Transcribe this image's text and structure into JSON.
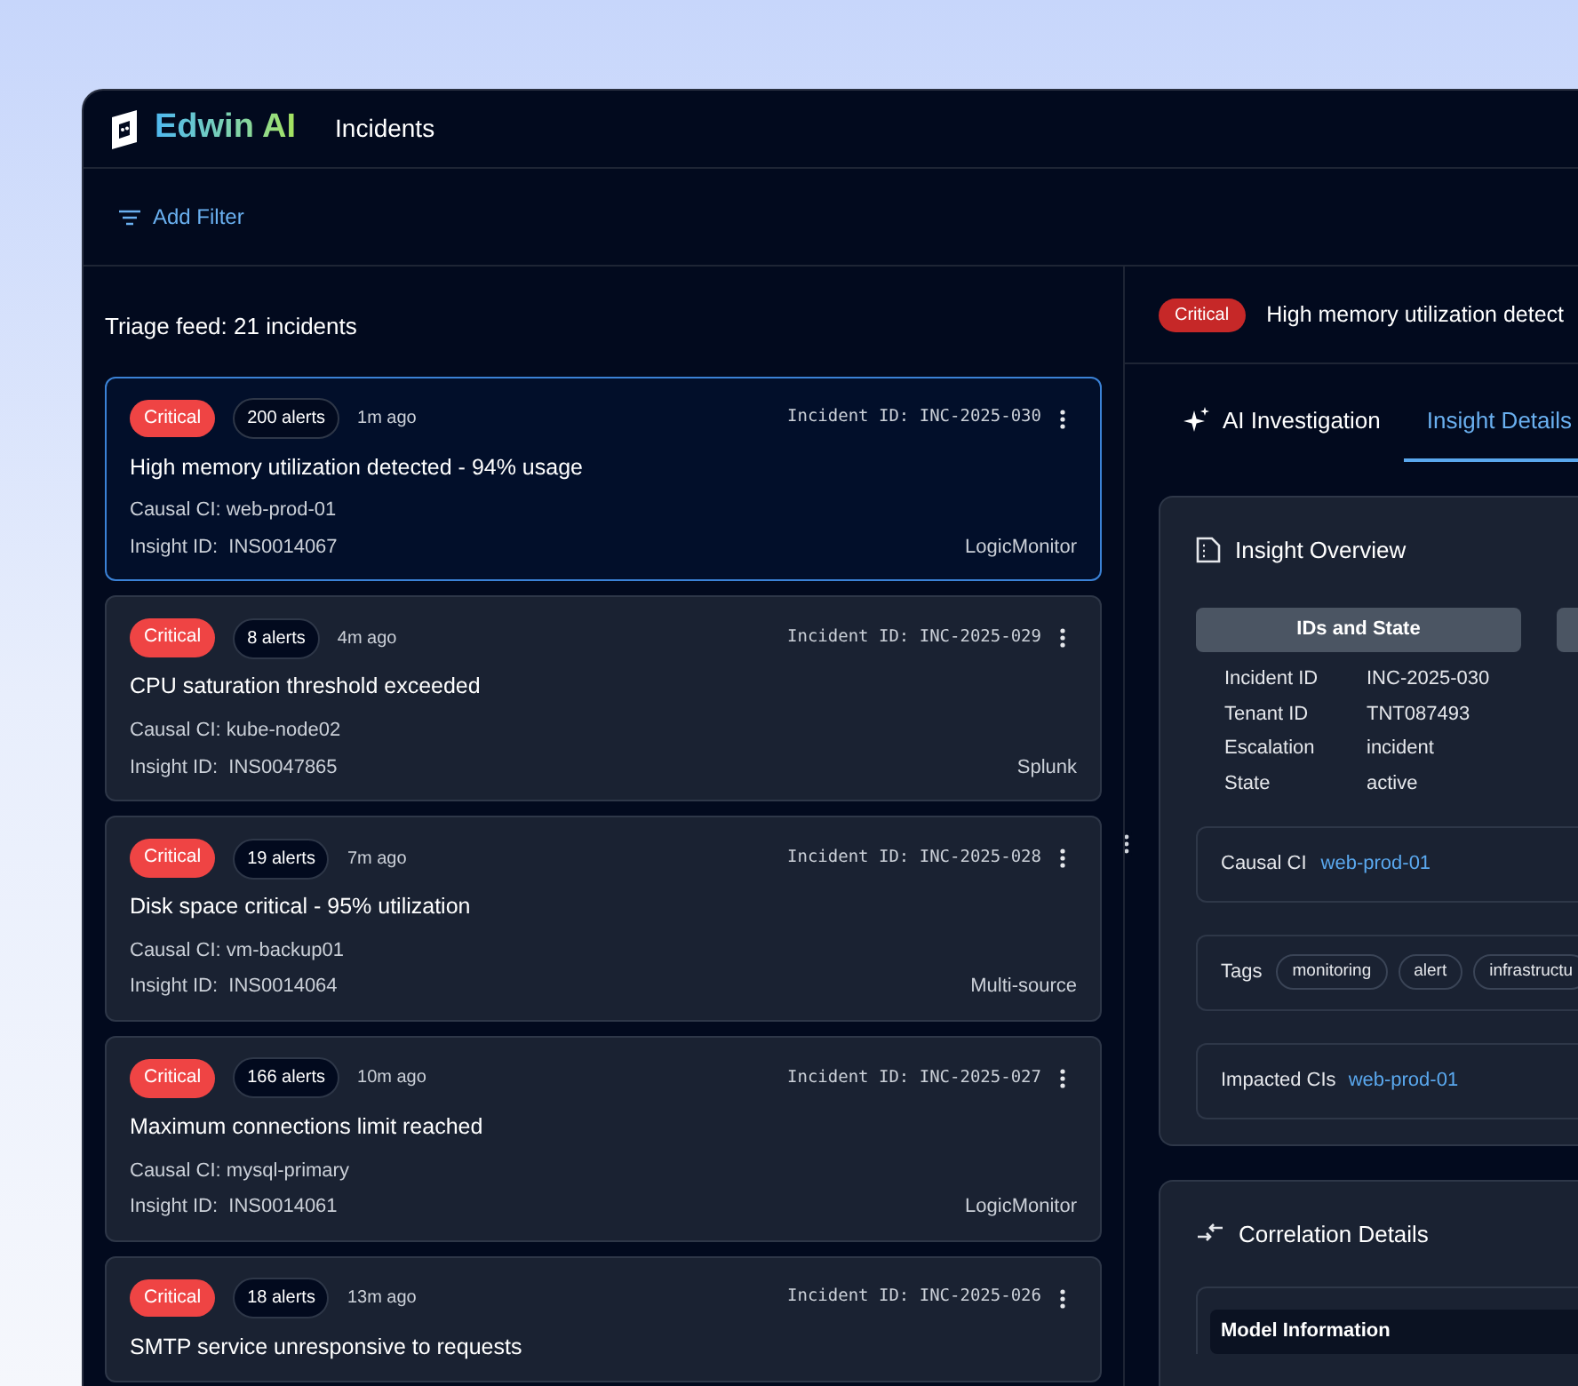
{
  "app": {
    "logo": "Edwin AI",
    "page_title": "Incidents"
  },
  "toolbar": {
    "add_filter": "Add Filter"
  },
  "feed": {
    "title": "Triage feed: 21 incidents",
    "incidents": [
      {
        "severity": "Critical",
        "alerts": "200 alerts",
        "age": "1m ago",
        "incident_id": "Incident ID: INC-2025-030",
        "title": "High memory utilization detected - 94% usage",
        "causal_ci": "Causal CI: web-prod-01",
        "insight_id": "Insight ID:  INS0014067",
        "source": "LogicMonitor",
        "selected": true
      },
      {
        "severity": "Critical",
        "alerts": "8 alerts",
        "age": "4m ago",
        "incident_id": "Incident ID: INC-2025-029",
        "title": "CPU saturation threshold exceeded",
        "causal_ci": "Causal CI: kube-node02",
        "insight_id": "Insight ID:  INS0047865",
        "source": "Splunk",
        "selected": false
      },
      {
        "severity": "Critical",
        "alerts": "19 alerts",
        "age": "7m ago",
        "incident_id": "Incident ID: INC-2025-028",
        "title": "Disk space critical - 95% utilization",
        "causal_ci": "Causal CI: vm-backup01",
        "insight_id": "Insight ID:  INS0014064",
        "source": "Multi-source",
        "selected": false
      },
      {
        "severity": "Critical",
        "alerts": "166 alerts",
        "age": "10m ago",
        "incident_id": "Incident ID: INC-2025-027",
        "title": "Maximum connections limit reached",
        "causal_ci": "Causal CI: mysql-primary",
        "insight_id": "Insight ID:  INS0014061",
        "source": "LogicMonitor",
        "selected": false
      },
      {
        "severity": "Critical",
        "alerts": "18 alerts",
        "age": "13m ago",
        "incident_id": "Incident ID: INC-2025-026",
        "title": "SMTP service unresponsive to requests",
        "selected": false
      }
    ]
  },
  "detail": {
    "severity": "Critical",
    "title": "High memory utilization detect",
    "tabs": [
      {
        "label": "AI Investigation",
        "selected": false
      },
      {
        "label": "Insight Details",
        "selected": true
      }
    ],
    "overview": {
      "title": "Insight Overview",
      "ids_header": "IDs and State",
      "fields": [
        {
          "label": "Incident ID",
          "value": "INC-2025-030"
        },
        {
          "label": "Tenant ID",
          "value": "TNT087493"
        },
        {
          "label": "Escalation",
          "value": "incident"
        },
        {
          "label": "State",
          "value": "active"
        }
      ],
      "causal_ci": {
        "label": "Causal CI",
        "value": "web-prod-01"
      },
      "tags": {
        "label": "Tags",
        "items": [
          "monitoring",
          "alert",
          "infrastructu"
        ]
      },
      "impacted_cis": {
        "label": "Impacted CIs",
        "value": "web-prod-01"
      }
    },
    "correlation": {
      "title": "Correlation Details",
      "model_header": "Model Information"
    }
  }
}
